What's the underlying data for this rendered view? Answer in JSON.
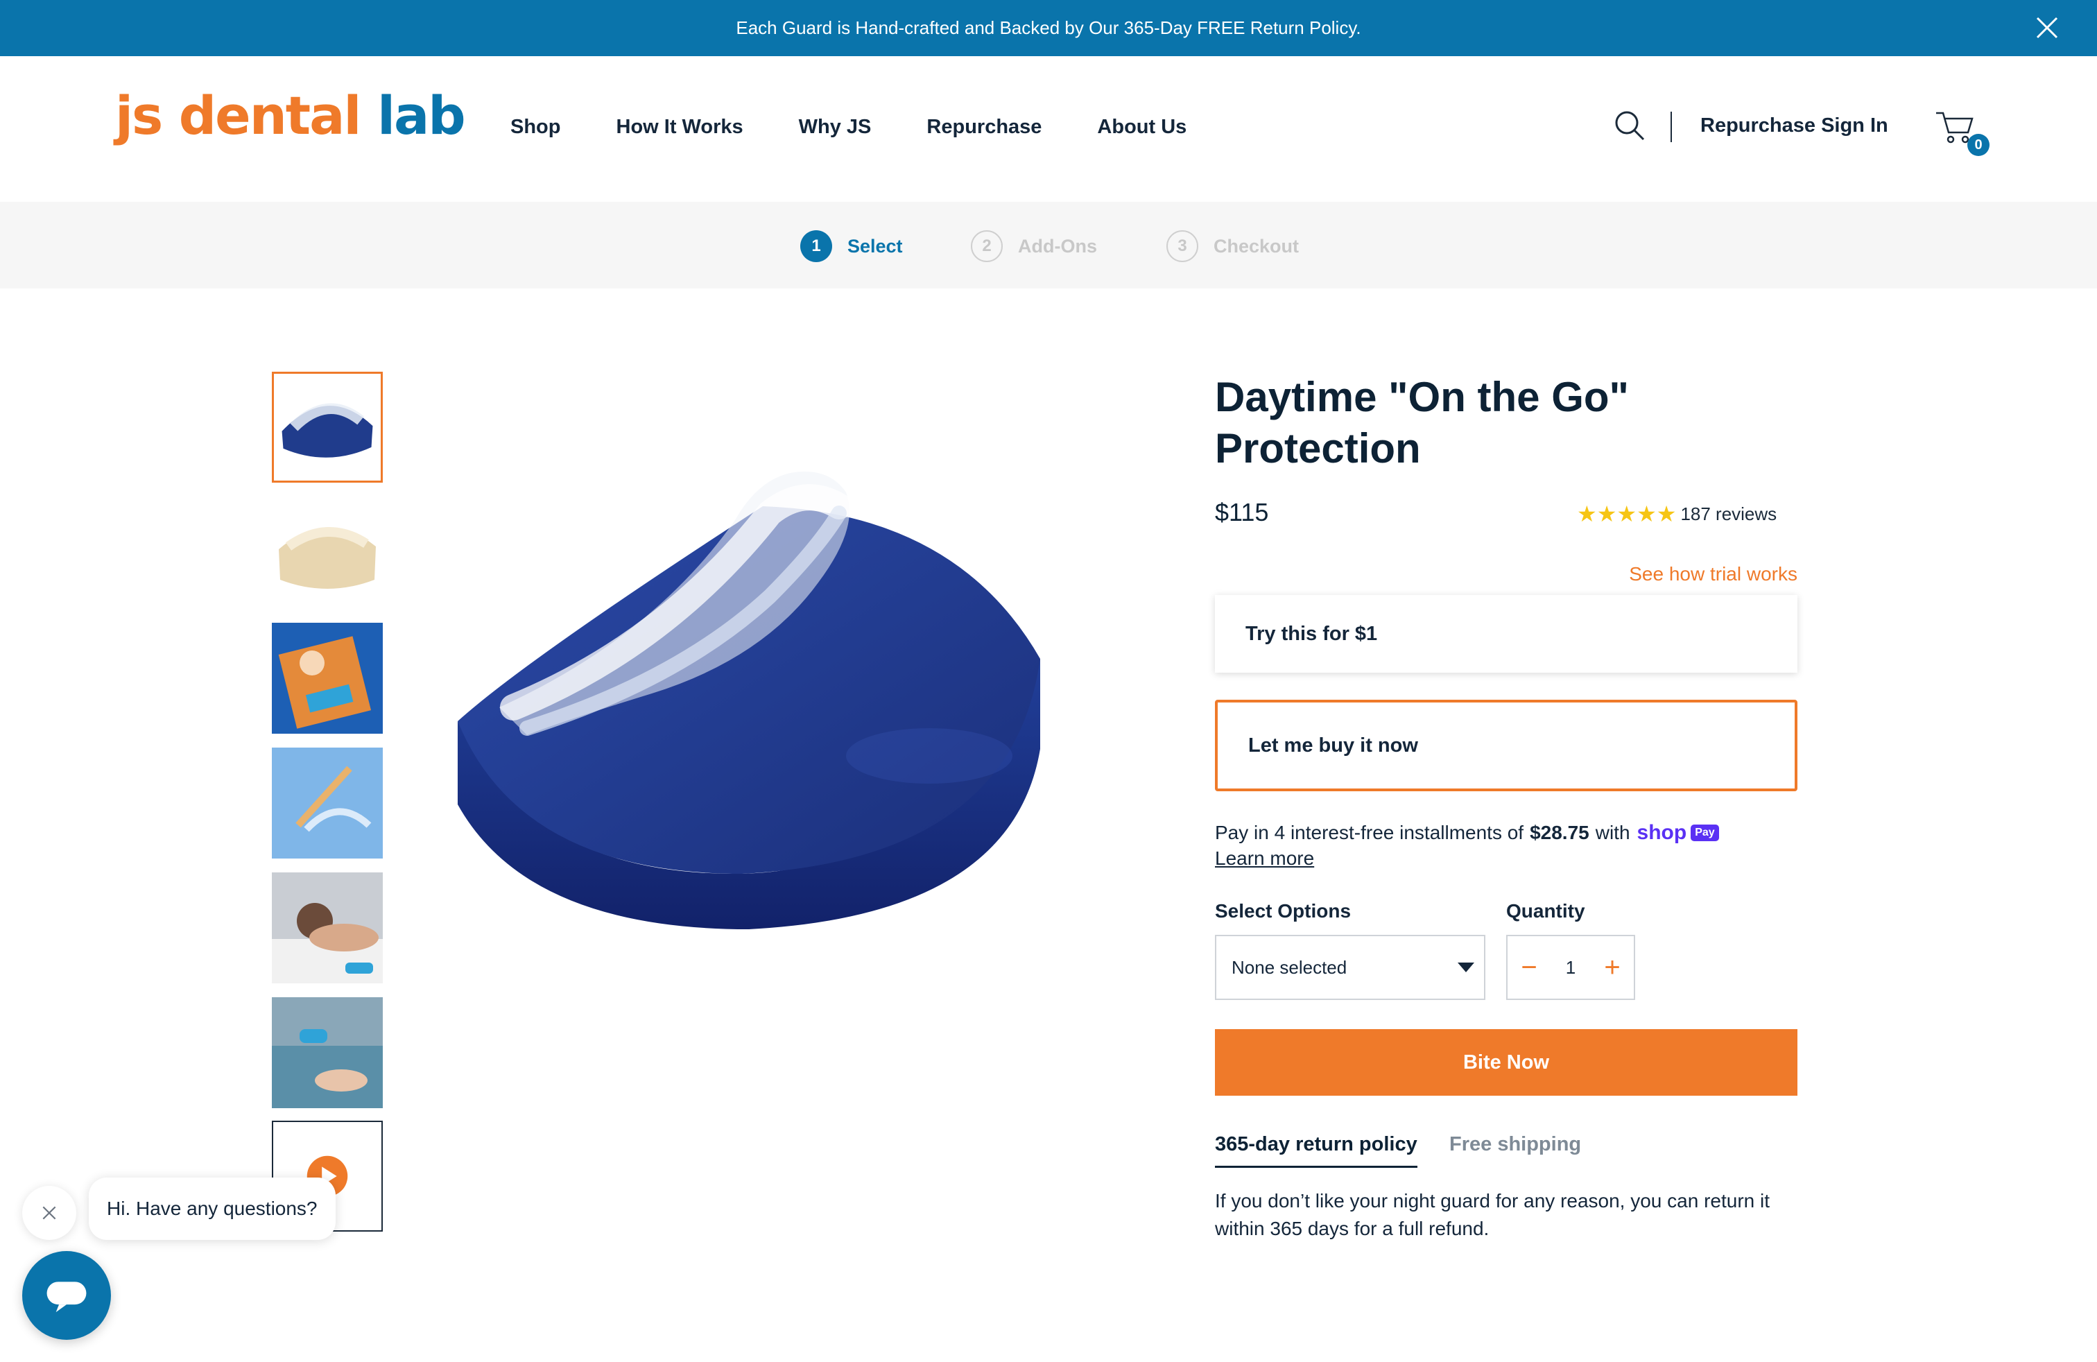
{
  "announcement": {
    "text": "Each Guard is Hand-crafted and Backed by Our 365-Day FREE Return Policy."
  },
  "header": {
    "logo": {
      "part1": "js dental ",
      "part2": "lab"
    },
    "nav": [
      "Shop",
      "How It Works",
      "Why JS",
      "Repurchase",
      "About Us"
    ],
    "signin_label": "Repurchase Sign In",
    "cart_count": "0"
  },
  "steps": [
    {
      "num": "1",
      "label": "Select",
      "state": "active"
    },
    {
      "num": "2",
      "label": "Add-Ons",
      "state": "inactive"
    },
    {
      "num": "3",
      "label": "Checkout",
      "state": "inactive"
    }
  ],
  "gallery": {
    "thumbnails": [
      "guard-on-case",
      "dental-model",
      "product-box",
      "toothbrush-and-guard",
      "woman-sleeping",
      "hands-with-guard",
      "video"
    ],
    "selected_index": 0
  },
  "product": {
    "title": "Daytime \"On the Go\" Protection",
    "price": "$115",
    "rating": {
      "stars": 5,
      "reviews": "187 reviews"
    },
    "trial_link": "See how trial works",
    "options": [
      {
        "label": "Try this for $1"
      },
      {
        "label": "Let me buy it now"
      }
    ],
    "pay": {
      "text_before": "Pay in 4 interest-free installments of",
      "amount": "$28.75",
      "text_after": "with",
      "brand": "shop",
      "badge": "Pay",
      "learn_more": "Learn more"
    },
    "select_options": {
      "label": "Select Options",
      "value": "None selected"
    },
    "quantity": {
      "label": "Quantity",
      "value": "1",
      "minus": "−",
      "plus": "+"
    },
    "cta": "Bite Now",
    "tabs": [
      {
        "label": "365-day return policy",
        "state": "active"
      },
      {
        "label": "Free shipping",
        "state": "inactive"
      }
    ],
    "tab_body": "If you don’t like your night guard for any reason, you can return it within 365 days for a full refund."
  },
  "chat": {
    "greeting": "Hi. Have any questions?"
  },
  "colors": {
    "brand_blue": "#0a74ab",
    "accent_orange": "#ef7a2a",
    "star_yellow": "#f6c515",
    "shop_purple": "#5a31f4"
  }
}
